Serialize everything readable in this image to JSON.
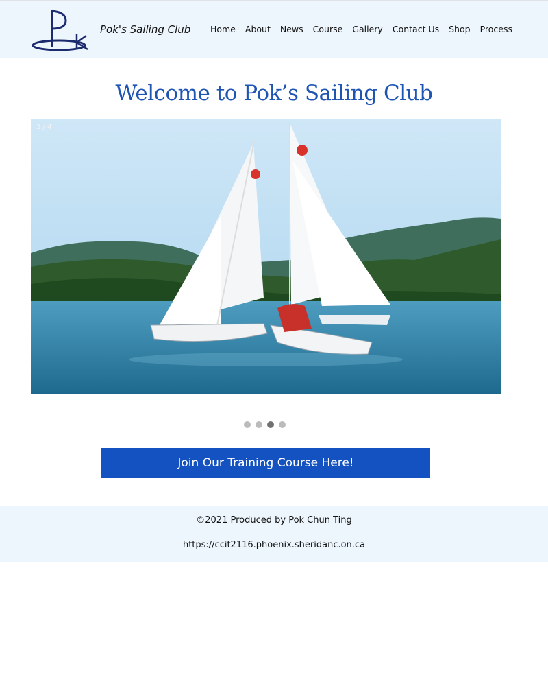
{
  "header": {
    "brand": "Pok's Sailing Club",
    "logo_icon": "pk-sailboat-logo-icon",
    "nav": [
      "Home",
      "About",
      "News",
      "Course",
      "Gallery",
      "Contact Us",
      "Shop",
      "Process"
    ]
  },
  "main": {
    "title": "Welcome to Pok’s Sailing Club",
    "slideshow": {
      "counter": "3 / 4",
      "current_slide": 3,
      "total_slides": 4,
      "image_icon": "sailboats-on-lake-photo"
    },
    "cta_label": "Join Our Training Course Here!"
  },
  "footer": {
    "copyright": "©2021 Produced by Pok Chun Ting",
    "url": "https://ccit2116.phoenix.sheridanc.on.ca"
  },
  "colors": {
    "header_bg": "#eef6fd",
    "title": "#1e55b3",
    "cta_bg": "#1552c1",
    "dot": "#bbbbbb",
    "dot_active": "#717171"
  }
}
